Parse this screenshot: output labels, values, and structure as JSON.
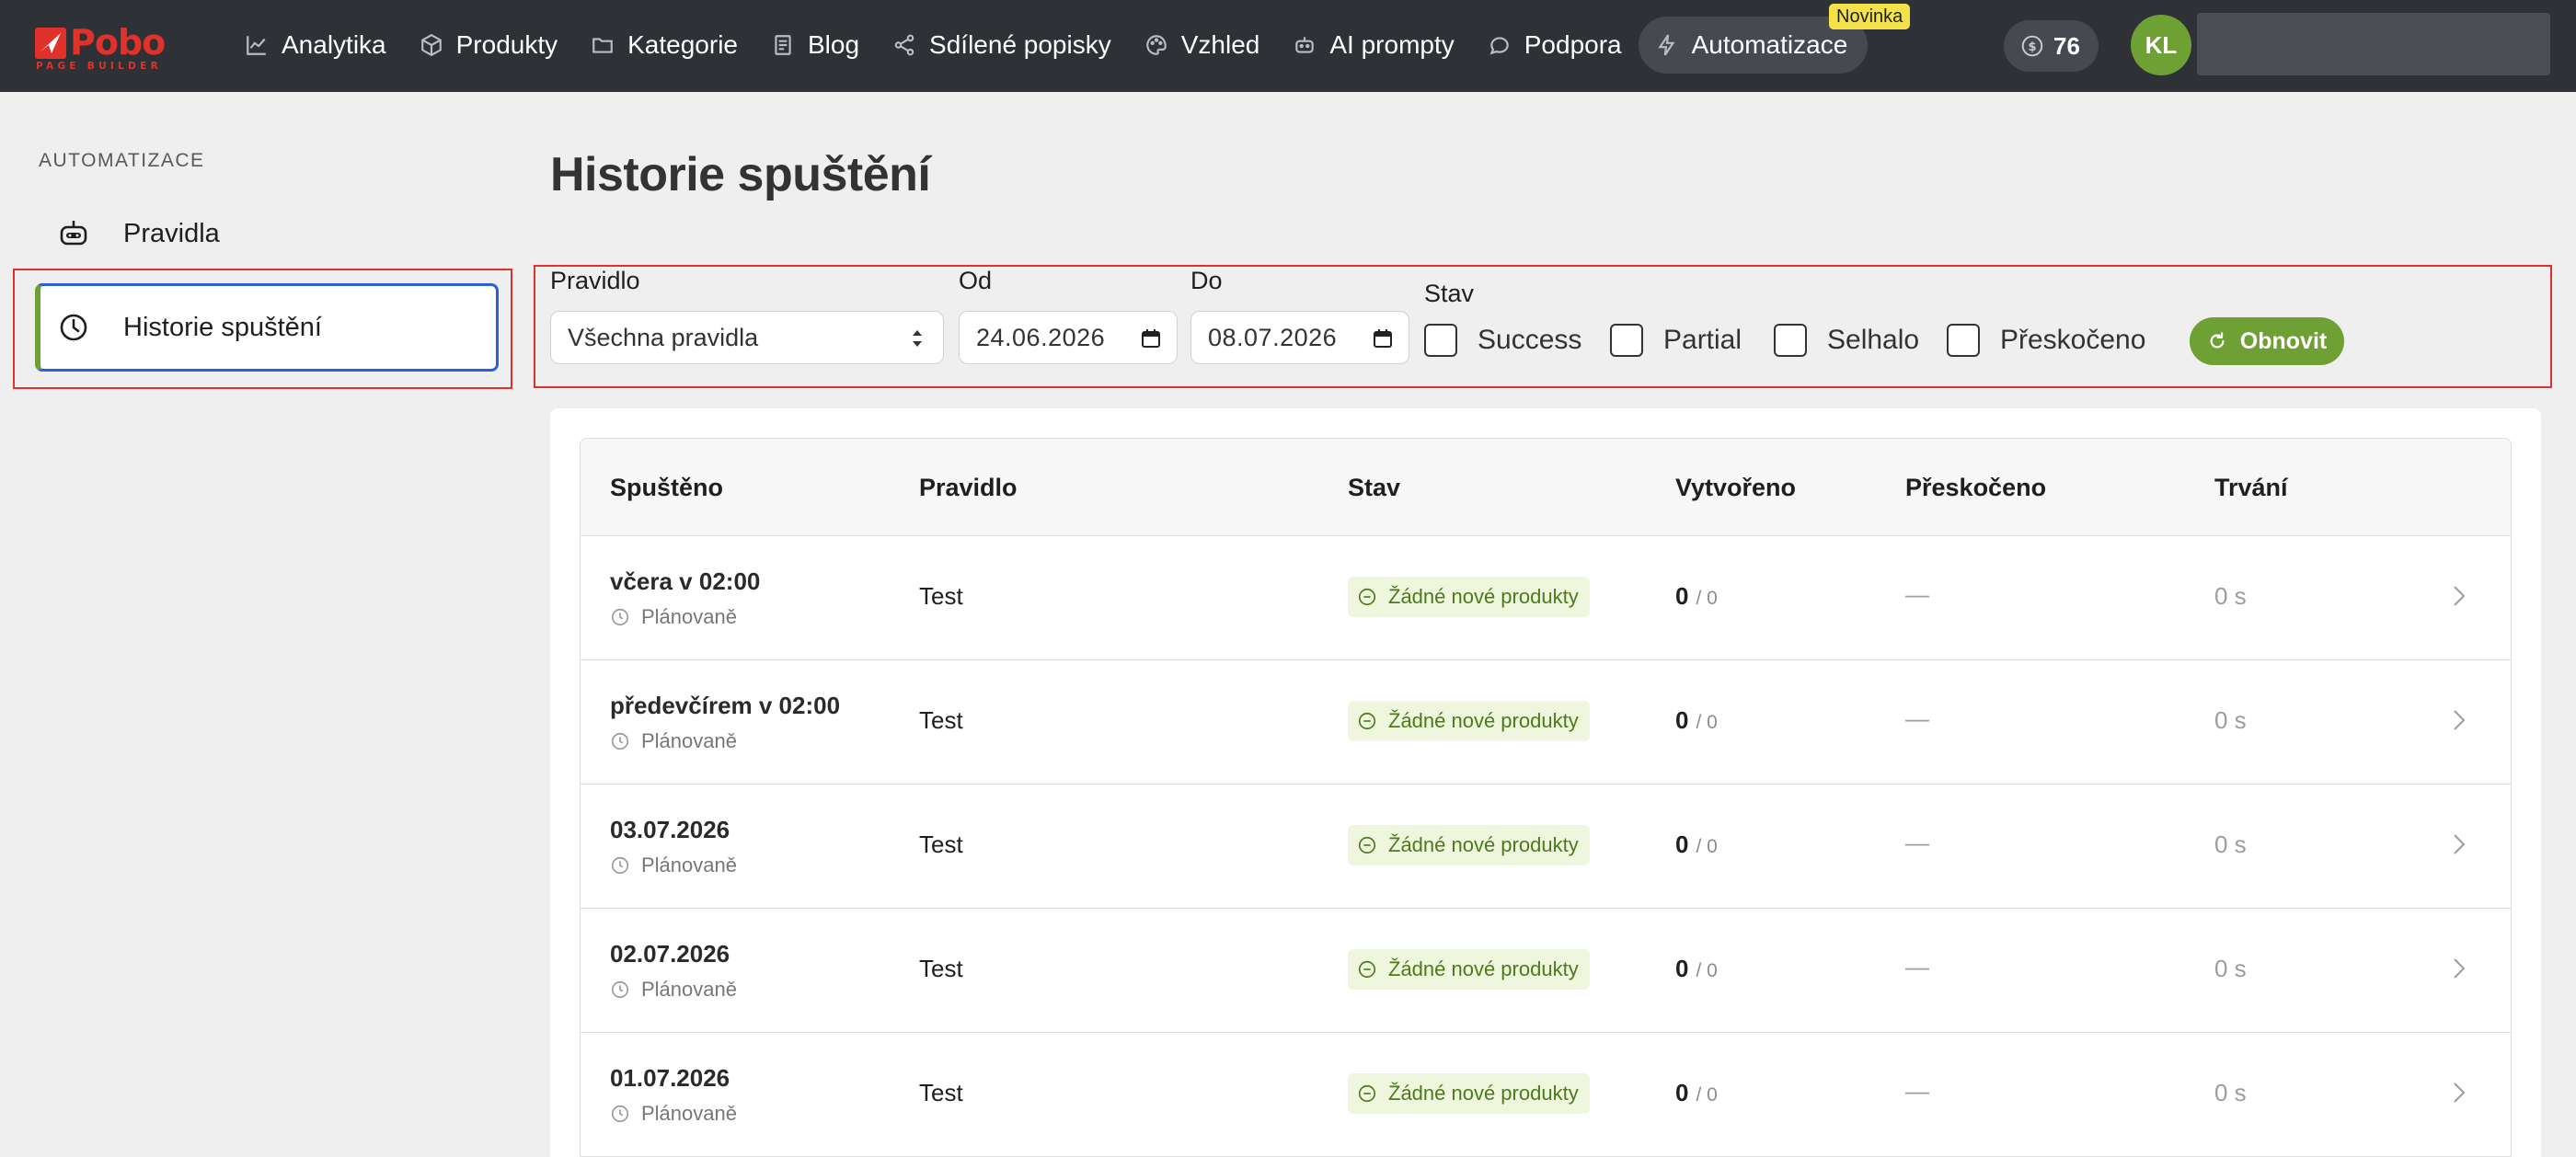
{
  "brand": {
    "name": "Pobo",
    "tagline": "PAGE BUILDER",
    "color": "#e0322b"
  },
  "nav": {
    "items": [
      {
        "label": "Analytika",
        "icon": "chart-line-icon"
      },
      {
        "label": "Produkty",
        "icon": "box-icon"
      },
      {
        "label": "Kategorie",
        "icon": "folder-icon"
      },
      {
        "label": "Blog",
        "icon": "document-icon"
      },
      {
        "label": "Sdílené popisky",
        "icon": "share-icon"
      },
      {
        "label": "Vzhled",
        "icon": "palette-icon"
      },
      {
        "label": "AI prompty",
        "icon": "robot-icon"
      },
      {
        "label": "Podpora",
        "icon": "chat-bubble-icon"
      },
      {
        "label": "Automatizace",
        "icon": "bolt-icon",
        "active": true,
        "badge": "Novinka"
      }
    ],
    "credits": "76",
    "avatar_initials": "KL"
  },
  "sidebar": {
    "heading": "AUTOMATIZACE",
    "items": [
      {
        "label": "Pravidla",
        "icon": "robot-icon"
      },
      {
        "label": "Historie spuštění",
        "icon": "clock-icon",
        "active": true
      }
    ]
  },
  "page": {
    "title": "Historie spuštění"
  },
  "filters": {
    "rule_label": "Pravidlo",
    "rule_value": "Všechna pravidla",
    "from_label": "Od",
    "from_value": "24.06.2026",
    "to_label": "Do",
    "to_value": "08.07.2026",
    "status_label": "Stav",
    "statuses": [
      {
        "label": "Success",
        "checked": false
      },
      {
        "label": "Partial",
        "checked": false
      },
      {
        "label": "Selhalo",
        "checked": false
      },
      {
        "label": "Přeskočeno",
        "checked": false
      }
    ],
    "refresh_label": "Obnovit"
  },
  "table": {
    "columns": [
      "Spuštěno",
      "Pravidlo",
      "Stav",
      "Vytvořeno",
      "Přeskočeno",
      "Trvání"
    ],
    "rows": [
      {
        "when": "včera v 02:00",
        "trigger": "Plánovaně",
        "rule": "Test",
        "status": "Žádné nové produkty",
        "created": "0",
        "created_total": "/ 0",
        "skipped": "—",
        "duration": "0 s"
      },
      {
        "when": "předevčírem v 02:00",
        "trigger": "Plánovaně",
        "rule": "Test",
        "status": "Žádné nové produkty",
        "created": "0",
        "created_total": "/ 0",
        "skipped": "—",
        "duration": "0 s"
      },
      {
        "when": "03.07.2026",
        "trigger": "Plánovaně",
        "rule": "Test",
        "status": "Žádné nové produkty",
        "created": "0",
        "created_total": "/ 0",
        "skipped": "—",
        "duration": "0 s"
      },
      {
        "when": "02.07.2026",
        "trigger": "Plánovaně",
        "rule": "Test",
        "status": "Žádné nové produkty",
        "created": "0",
        "created_total": "/ 0",
        "skipped": "—",
        "duration": "0 s"
      },
      {
        "when": "01.07.2026",
        "trigger": "Plánovaně",
        "rule": "Test",
        "status": "Žádné nové produkty",
        "created": "0",
        "created_total": "/ 0",
        "skipped": "—",
        "duration": "0 s"
      }
    ]
  },
  "colors": {
    "accent": "#6fa033",
    "focus": "#2c5fd6",
    "topbar": "#2e3136",
    "status_bg": "#eef6dd",
    "status_text": "#4d7a1b"
  }
}
